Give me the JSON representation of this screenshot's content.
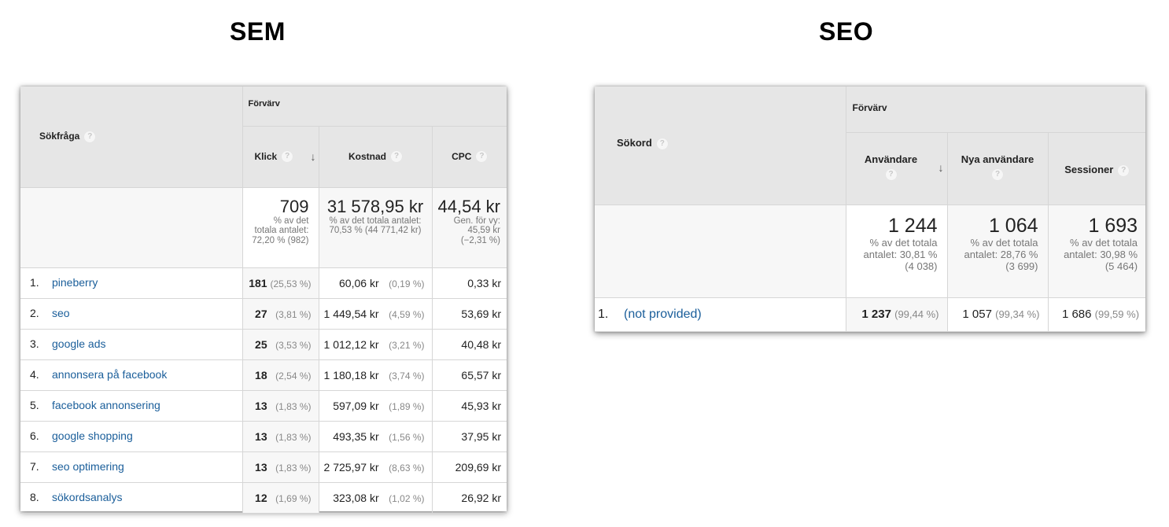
{
  "sem": {
    "title": "SEM",
    "dimension_header": "Sökfråga",
    "group_header": "Förvärv",
    "columns": [
      {
        "label": "Klick",
        "sorted": true
      },
      {
        "label": "Kostnad",
        "sorted": false
      },
      {
        "label": "CPC",
        "sorted": false
      }
    ],
    "totals": [
      {
        "value": "709",
        "lines": [
          "% av det",
          "totala antalet:",
          "72,20 % (982)"
        ]
      },
      {
        "value": "31 578,95 kr",
        "lines": [
          "% av det totala antalet:",
          "70,53 % (44 771,42 kr)"
        ]
      },
      {
        "value": "44,54 kr",
        "lines": [
          "Gen. för vy:",
          "45,59 kr",
          "(−2,31 %)"
        ]
      }
    ],
    "rows": [
      {
        "index": "1.",
        "query": "pineberry",
        "clicks": "181",
        "clicks_pct": "(25,53 %)",
        "cost": "60,06 kr",
        "cost_pct": "(0,19 %)",
        "cpc": "0,33 kr"
      },
      {
        "index": "2.",
        "query": "seo",
        "clicks": "27",
        "clicks_pct": "(3,81 %)",
        "cost": "1 449,54 kr",
        "cost_pct": "(4,59 %)",
        "cpc": "53,69 kr"
      },
      {
        "index": "3.",
        "query": "google ads",
        "clicks": "25",
        "clicks_pct": "(3,53 %)",
        "cost": "1 012,12 kr",
        "cost_pct": "(3,21 %)",
        "cpc": "40,48 kr"
      },
      {
        "index": "4.",
        "query": "annonsera på facebook",
        "clicks": "18",
        "clicks_pct": "(2,54 %)",
        "cost": "1 180,18 kr",
        "cost_pct": "(3,74 %)",
        "cpc": "65,57 kr"
      },
      {
        "index": "5.",
        "query": "facebook annonsering",
        "clicks": "13",
        "clicks_pct": "(1,83 %)",
        "cost": "597,09 kr",
        "cost_pct": "(1,89 %)",
        "cpc": "45,93 kr"
      },
      {
        "index": "6.",
        "query": "google shopping",
        "clicks": "13",
        "clicks_pct": "(1,83 %)",
        "cost": "493,35 kr",
        "cost_pct": "(1,56 %)",
        "cpc": "37,95 kr"
      },
      {
        "index": "7.",
        "query": "seo optimering",
        "clicks": "13",
        "clicks_pct": "(1,83 %)",
        "cost": "2 725,97 kr",
        "cost_pct": "(8,63 %)",
        "cpc": "209,69 kr"
      },
      {
        "index": "8.",
        "query": "sökordsanalys",
        "clicks": "12",
        "clicks_pct": "(1,69 %)",
        "cost": "323,08 kr",
        "cost_pct": "(1,02 %)",
        "cpc": "26,92 kr"
      }
    ]
  },
  "seo": {
    "title": "SEO",
    "dimension_header": "Sökord",
    "group_header": "Förvärv",
    "columns": [
      {
        "label": "Användare",
        "sorted": true
      },
      {
        "label": "Nya användare",
        "sorted": false
      },
      {
        "label": "Sessioner",
        "sorted": false
      }
    ],
    "totals": [
      {
        "value": "1 244",
        "lines": [
          "% av det totala",
          "antalet: 30,81 %",
          "(4 038)"
        ]
      },
      {
        "value": "1 064",
        "lines": [
          "% av det totala",
          "antalet: 28,76 %",
          "(3 699)"
        ]
      },
      {
        "value": "1 693",
        "lines": [
          "% av det totala",
          "antalet: 30,98 %",
          "(5 464)"
        ]
      }
    ],
    "rows": [
      {
        "index": "1.",
        "keyword": "(not provided)",
        "users": "1 237",
        "users_pct": "(99,44 %)",
        "new_users": "1 057",
        "new_users_pct": "(99,34 %)",
        "sessions": "1 686",
        "sessions_pct": "(99,59 %)"
      }
    ]
  },
  "icons": {
    "help": "?",
    "sort_down": "↓"
  }
}
